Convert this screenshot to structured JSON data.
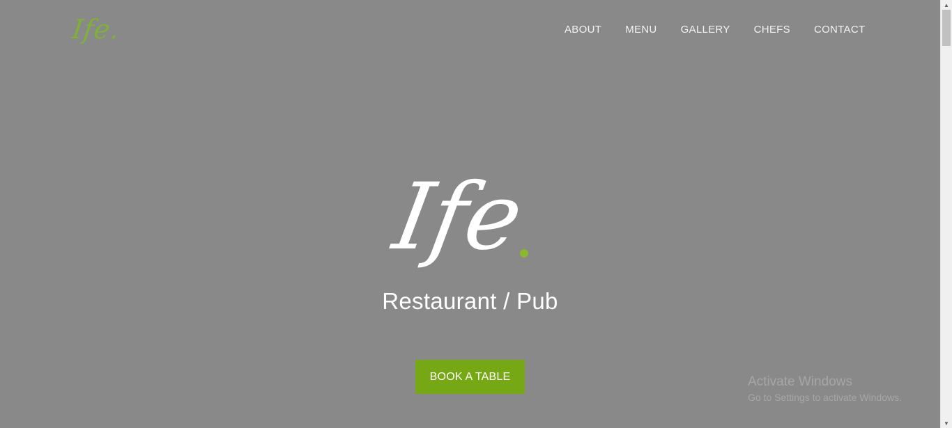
{
  "brand": {
    "logo_text": "Ife.",
    "accent_color": "#75a814"
  },
  "nav": {
    "items": [
      {
        "label": "ABOUT"
      },
      {
        "label": "MENU"
      },
      {
        "label": "GALLERY"
      },
      {
        "label": "CHEFS"
      },
      {
        "label": "CONTACT"
      }
    ]
  },
  "hero": {
    "logo_text": "Ife",
    "subtitle": "Restaurant / Pub",
    "cta_label": "BOOK A TABLE"
  },
  "watermark": {
    "title": "Activate Windows",
    "subtitle": "Go to Settings to activate Windows."
  },
  "scrollbar": {
    "up_icon": "▲",
    "down_icon": "▼"
  }
}
